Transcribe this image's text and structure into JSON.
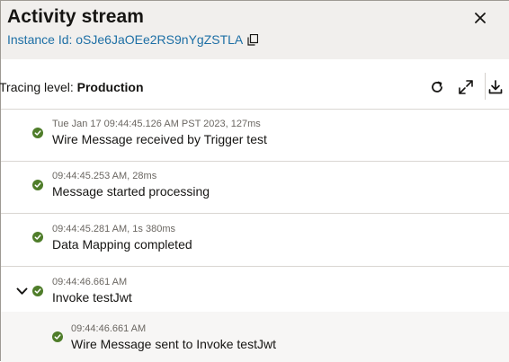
{
  "header": {
    "title": "Activity stream",
    "instance_label": "Instance Id: oSJe6JaOEe2RS9nYgZSTLA"
  },
  "toolbar": {
    "tracing_prefix": "Tracing level:",
    "tracing_value": "Production"
  },
  "events": [
    {
      "timestamp": "Tue Jan 17 09:44:45.126 AM PST 2023, 127ms",
      "message": "Wire Message received by Trigger test",
      "status": "success"
    },
    {
      "timestamp": "09:44:45.253 AM, 28ms",
      "message": "Message started processing",
      "status": "success"
    },
    {
      "timestamp": "09:44:45.281 AM, 1s 380ms",
      "message": "Data Mapping completed",
      "status": "success"
    },
    {
      "timestamp": "09:44:46.661 AM",
      "message": "Invoke testJwt",
      "status": "success",
      "expanded": true
    },
    {
      "timestamp": "09:44:46.661 AM",
      "message": "Wire Message sent to Invoke testJwt",
      "status": "success",
      "child": true
    }
  ],
  "colors": {
    "header_bg": "#f1efed",
    "link": "#1d6fa5",
    "success": "#4f7d2a"
  },
  "icons": [
    "copy-icon",
    "close-icon",
    "refresh-icon",
    "expand-icon",
    "download-icon",
    "check-icon",
    "chevron-down-icon"
  ]
}
